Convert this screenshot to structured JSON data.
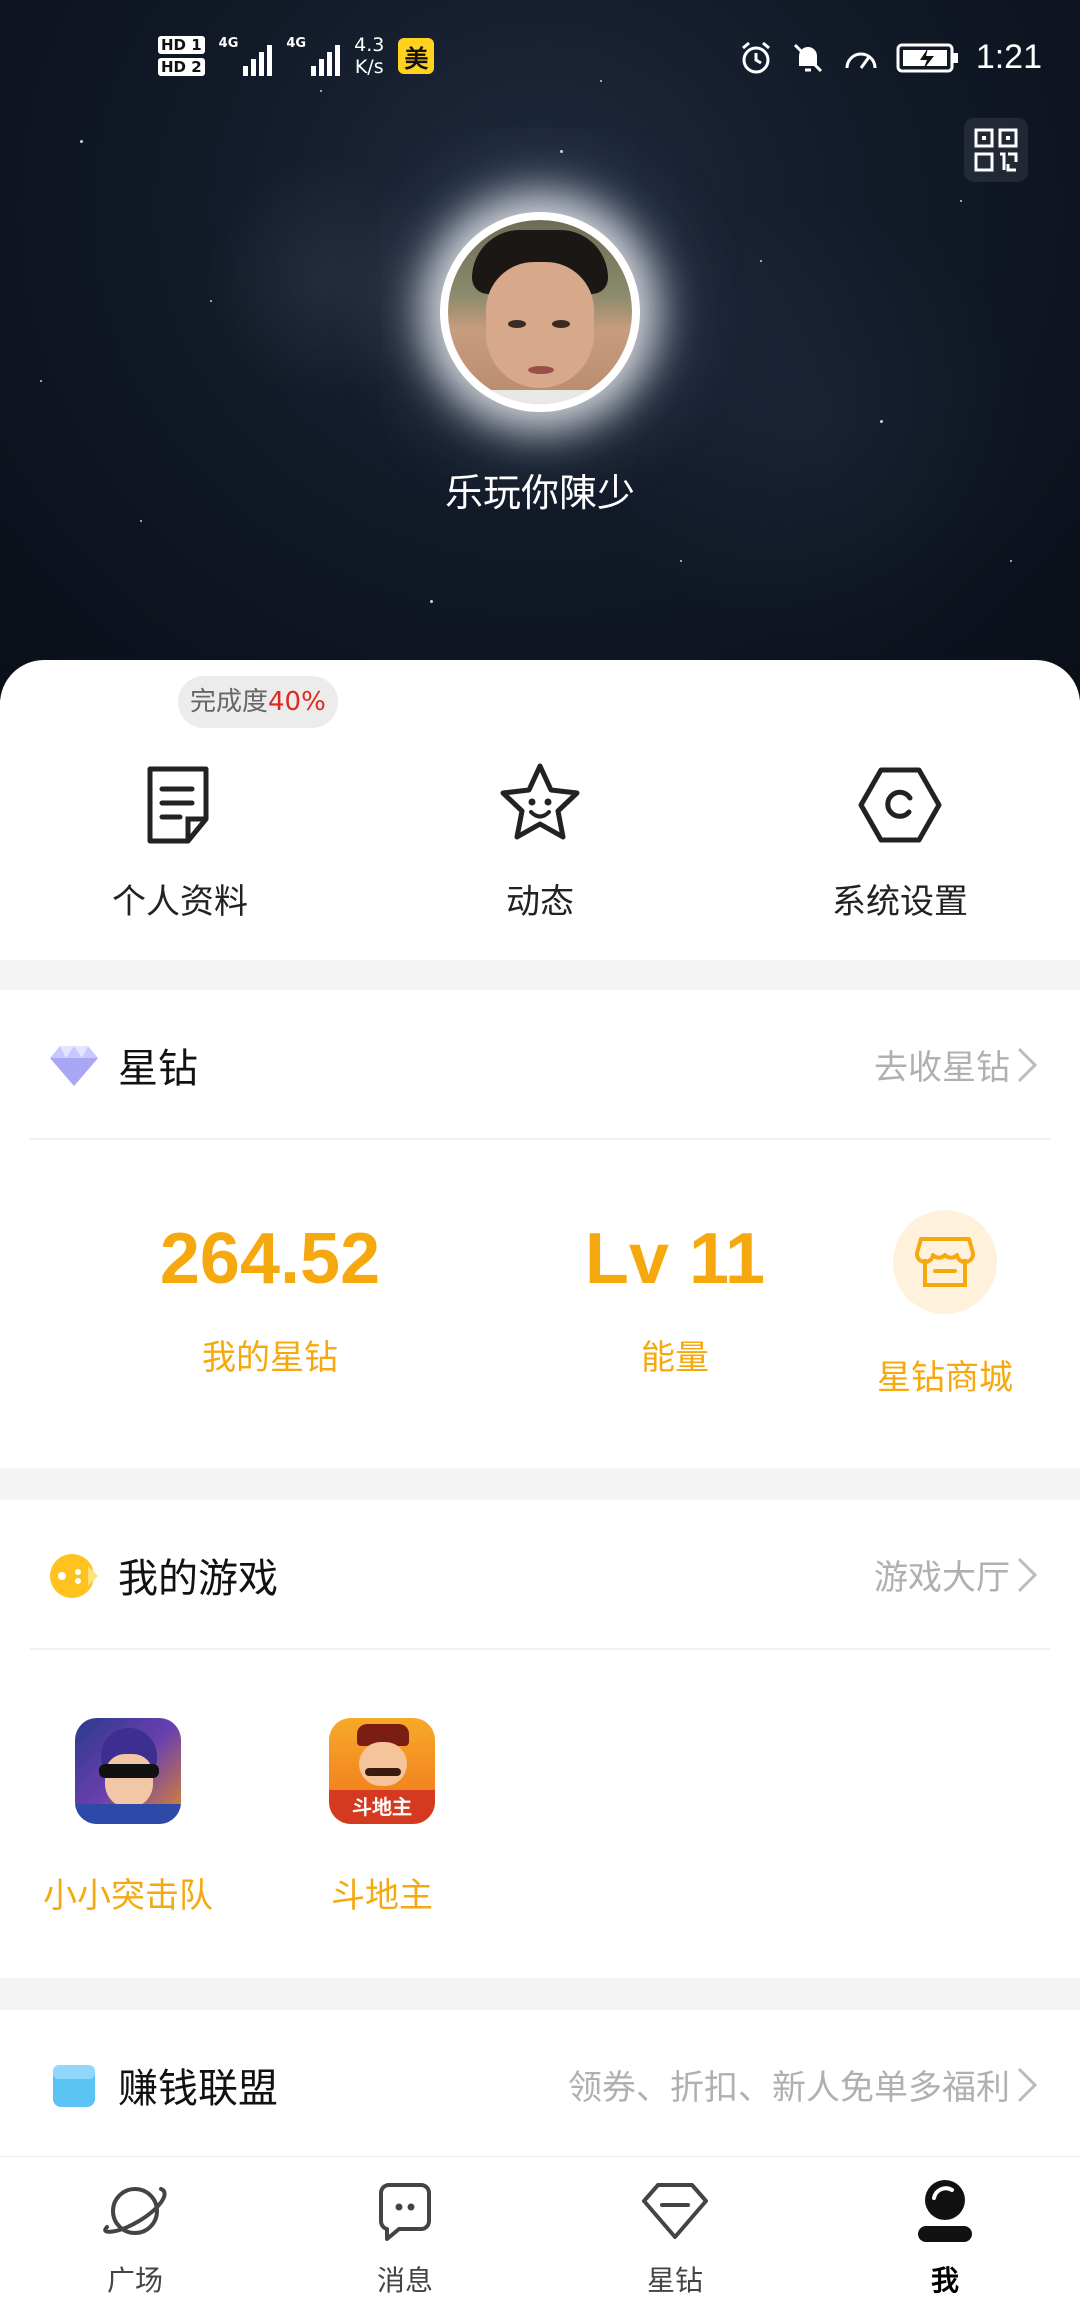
{
  "status_bar": {
    "hd1": "HD 1",
    "hd2": "HD 2",
    "net1": "4G",
    "net2": "4G",
    "speed_value": "4.3",
    "speed_unit": "K/s",
    "app_badge": "美",
    "time": "1:21",
    "icons": [
      "alarm-icon",
      "mute-bell-icon",
      "speedometer-icon",
      "battery-charging-icon"
    ]
  },
  "profile": {
    "username": "乐玩你陳少",
    "completion_prefix": "完成度",
    "completion_value": "40%",
    "completion_color": "#e0271d"
  },
  "shortcuts": [
    {
      "label": "个人资料",
      "icon": "document-icon"
    },
    {
      "label": "动态",
      "icon": "smiling-star-icon"
    },
    {
      "label": "系统设置",
      "icon": "hexagon-settings-icon"
    }
  ],
  "star_diamond": {
    "title": "星钻",
    "more": "去收星钻",
    "balance": "264.52",
    "balance_label": "我的星钻",
    "energy": "Lv 11",
    "energy_label": "能量",
    "shop_label": "星钻商城",
    "accent": "#f5a90f"
  },
  "games": {
    "title": "我的游戏",
    "more": "游戏大厅",
    "items": [
      {
        "label": "小小突击队",
        "icon": "game-soldier-icon"
      },
      {
        "label": "斗地主",
        "icon": "game-landlord-icon",
        "tile_text": "斗地主"
      }
    ]
  },
  "alliance": {
    "title": "赚钱联盟",
    "more": "领券、折扣、新人免单多福利"
  },
  "tabbar": [
    {
      "label": "广场",
      "icon": "planet-icon",
      "active": false
    },
    {
      "label": "消息",
      "icon": "chat-bubble-icon",
      "active": false
    },
    {
      "label": "星钻",
      "icon": "diamond-icon",
      "active": false
    },
    {
      "label": "我",
      "icon": "profile-icon",
      "active": true
    }
  ]
}
